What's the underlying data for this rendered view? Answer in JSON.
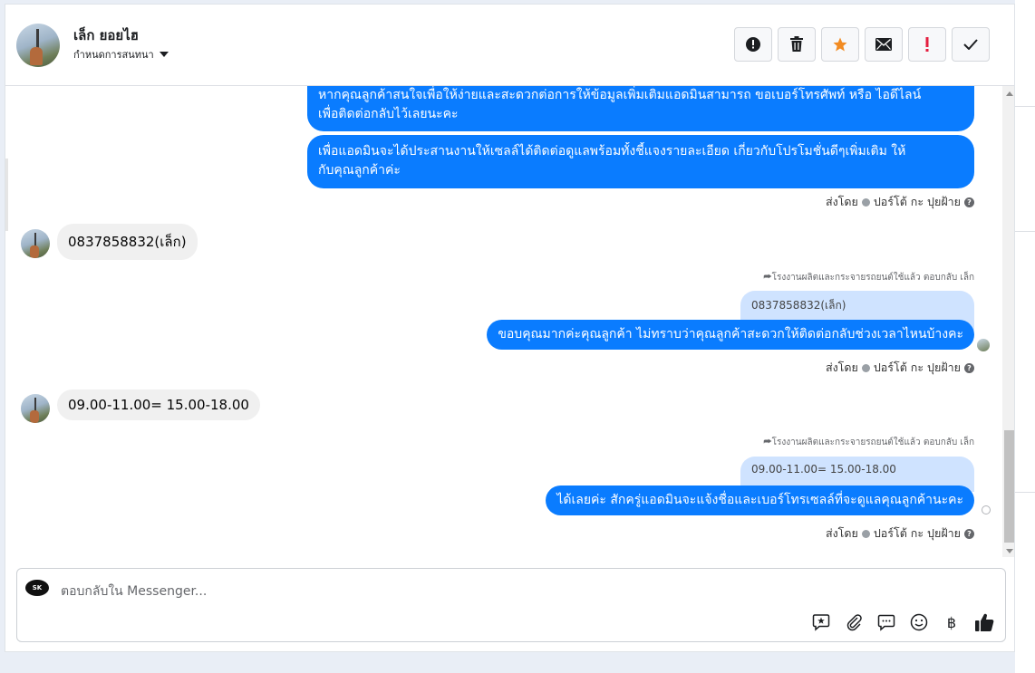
{
  "header": {
    "contact_name": "เล็ก ยอยไฮ",
    "assign_label": "กำหนดการสนทนา",
    "toolbar": [
      {
        "name": "spam-button",
        "icon": "alert-circle-icon"
      },
      {
        "name": "delete-button",
        "icon": "trash-icon"
      },
      {
        "name": "star-button",
        "icon": "star-icon"
      },
      {
        "name": "mark-unread-button",
        "icon": "mail-icon"
      },
      {
        "name": "priority-button",
        "icon": "exclamation-icon"
      },
      {
        "name": "done-button",
        "icon": "check-icon"
      }
    ],
    "colors": {
      "star": "#f28b22",
      "priority": "#e41e3f"
    }
  },
  "messages": {
    "out1_line1": "หากคุณลูกค้าสนใจเพื่อให้ง่ายและสะดวกต่อการให้ข้อมูลเพิ่มเติมแอดมินสามารถ ขอเบอร์โทรศัพท์ หรือ ไอดีไลน์",
    "out1_line2": "เพื่อติดต่อกลับไว้เลยนะคะ",
    "out2_line1": "เพื่อแอดมินจะได้ประสานงานให้เซลล์ได้ติดต่อดูแลพร้อมทั้งชี้แจงรายละเอียด เกี่ยวกับโปรโมชั่นดีๆเพิ่มเติม ให้",
    "out2_line2": "กับคุณลูกค้าค่ะ",
    "meta1_prefix": "ส่งโดย",
    "meta1_name": "ปอร์โต้ กะ ปุยฝ้าย",
    "in1": "0837858832(เล็ก)",
    "replied1": "โรงงานผลิตและกระจายรถยนต์ใช้แล้ว ตอบกลับ เล็ก",
    "reply_ref1": "0837858832(เล็ก)",
    "out3": "ขอบคุณมากค่ะคุณลูกค้า ไม่ทราบว่าคุณลูกค้าสะดวกให้ติดต่อกลับช่วงเวลาไหนบ้างคะ",
    "meta2_prefix": "ส่งโดย",
    "meta2_name": "ปอร์โต้ กะ ปุยฝ้าย",
    "in2": "09.00-11.00= 15.00-18.00",
    "replied2": "โรงงานผลิตและกระจายรถยนต์ใช้แล้ว ตอบกลับ เล็ก",
    "reply_ref2": "09.00-11.00= 15.00-18.00",
    "out4": "ได้เลยค่ะ สักครู่แอดมินจะแจ้งชื่อและเบอร์โทรเซลล์ที่จะดูแลคุณลูกค้านะคะ",
    "meta3_prefix": "ส่งโดย",
    "meta3_name": "ปอร์โต้ กะ ปุยฝ้าย"
  },
  "composer": {
    "placeholder": "ตอบกลับใน Messenger...",
    "page_logo_text": "SK",
    "tools": [
      "saved-reply-icon",
      "attachment-icon",
      "chat-bubble-icon",
      "emoji-icon",
      "baht-icon",
      "like-icon"
    ],
    "baht_symbol": "฿"
  },
  "colors": {
    "accent": "#0a7cff",
    "reply_bg": "#cfe3ff",
    "incoming_bg": "#f0f0f0"
  }
}
